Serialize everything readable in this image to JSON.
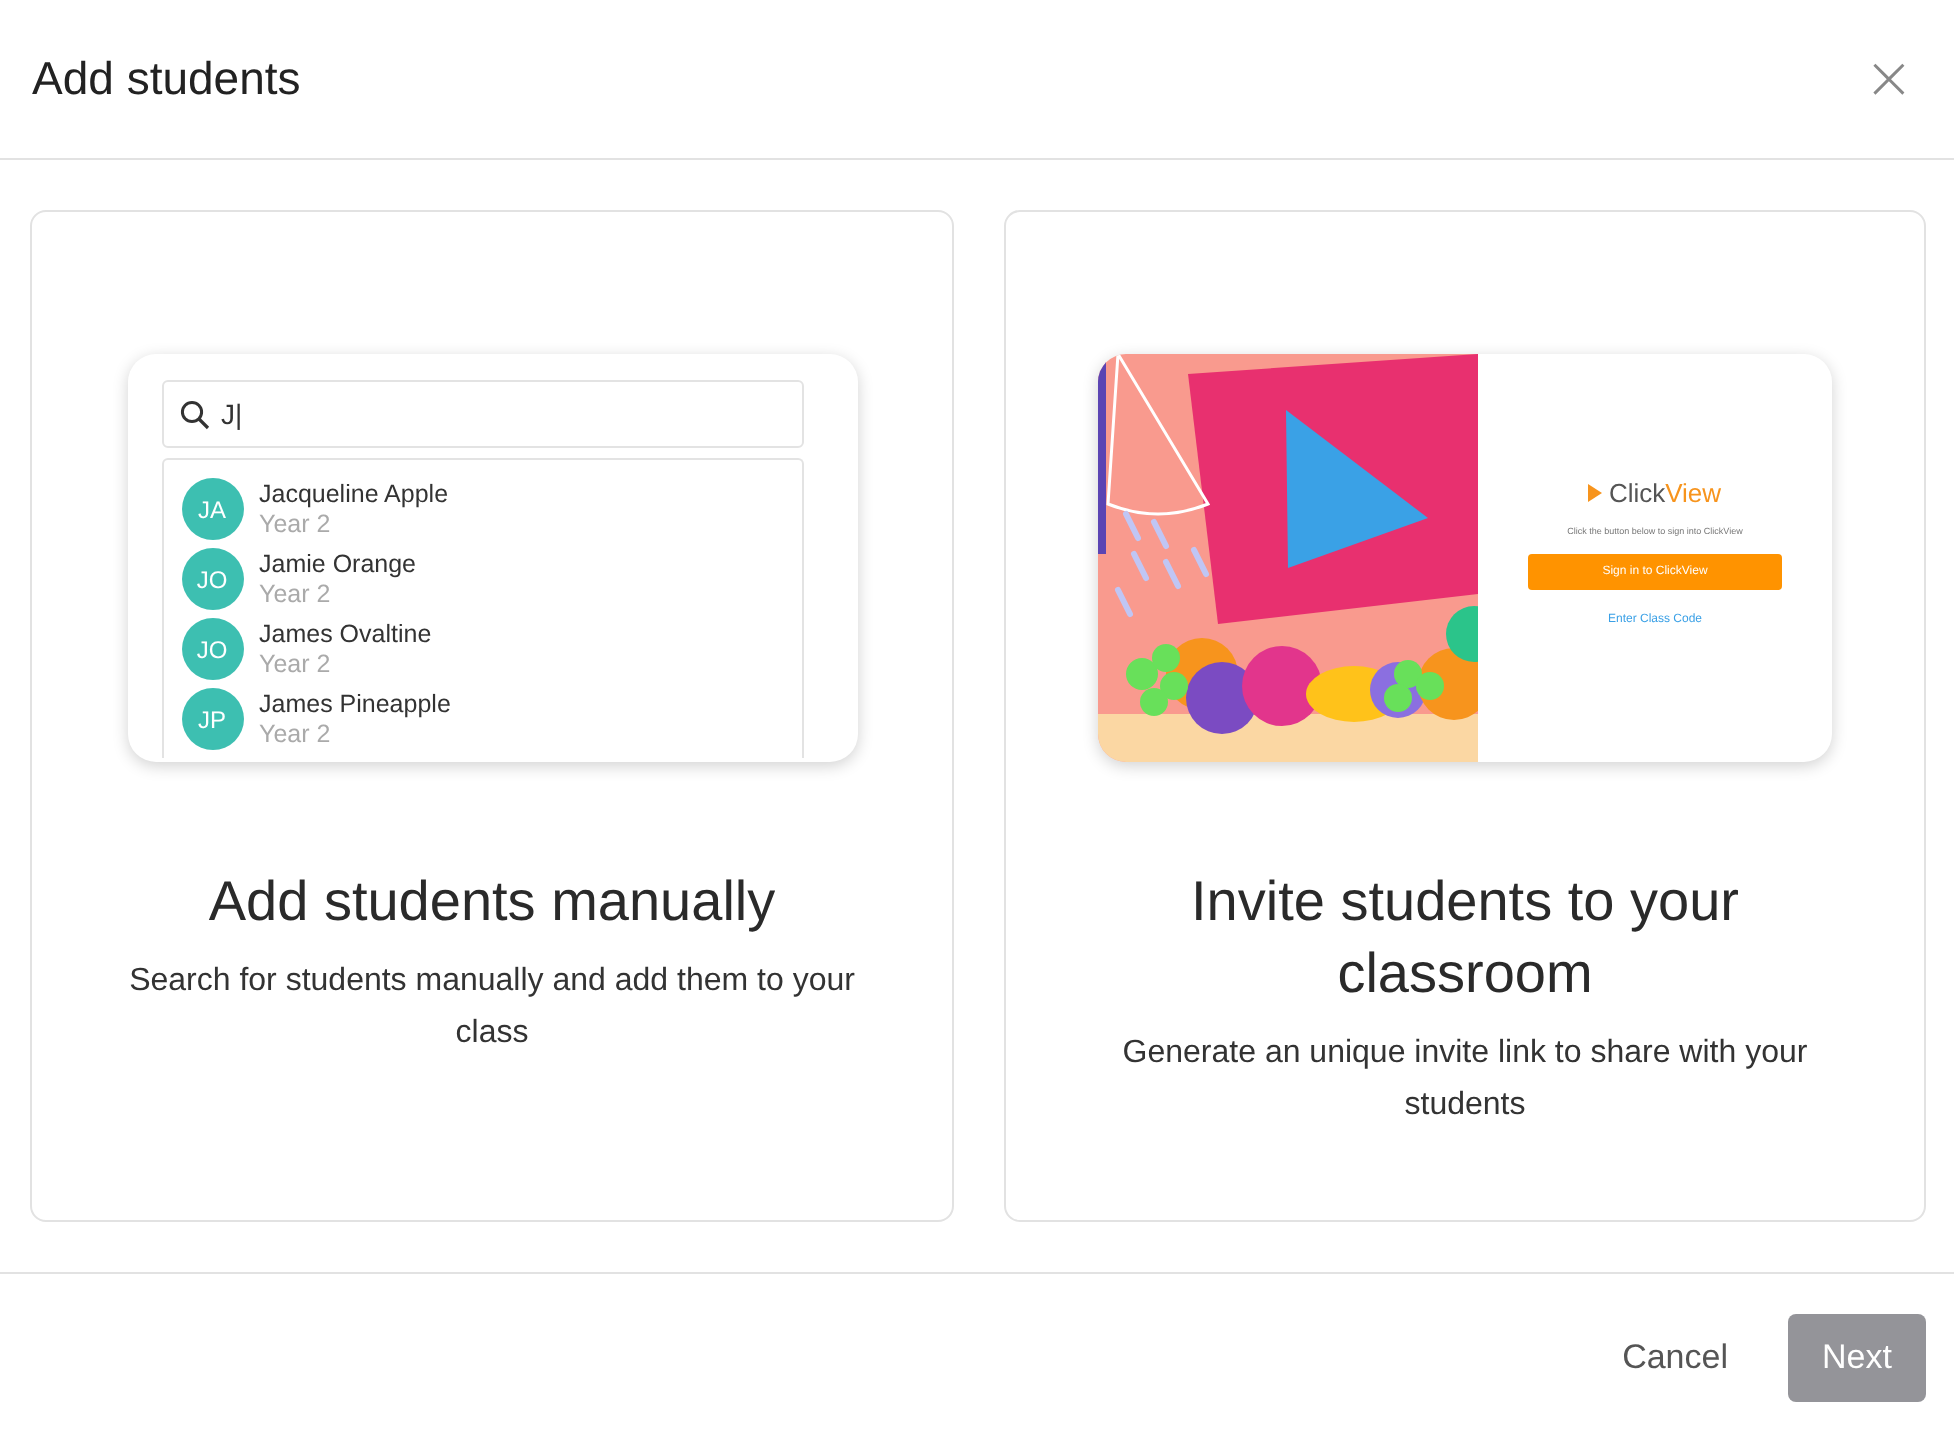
{
  "dialog": {
    "title": "Add students",
    "close": "×"
  },
  "options": [
    {
      "kind": "manual",
      "title": "Add students manually",
      "description": "Search for students manually and add them to your class",
      "preview": {
        "search_value": "J|",
        "students": [
          {
            "initials": "JA",
            "name": "Jacqueline Apple",
            "year": "Year 2"
          },
          {
            "initials": "JO",
            "name": "Jamie Orange",
            "year": "Year 2"
          },
          {
            "initials": "JO",
            "name": "James Ovaltine",
            "year": "Year 2"
          },
          {
            "initials": "JP",
            "name": "James Pineapple",
            "year": "Year 2"
          }
        ]
      }
    },
    {
      "kind": "invite",
      "title": "Invite students to your classroom",
      "description": "Generate an unique invite link to share with your students",
      "preview": {
        "logo": {
          "text": "Click",
          "accent": "View"
        },
        "hint": "Click the button below to sign into ClickView",
        "sign_in": "Sign in to ClickView",
        "class_code": "Enter Class Code"
      }
    }
  ],
  "footer": {
    "cancel": "Cancel",
    "next": {
      "label": "Next",
      "disabled": true
    }
  }
}
